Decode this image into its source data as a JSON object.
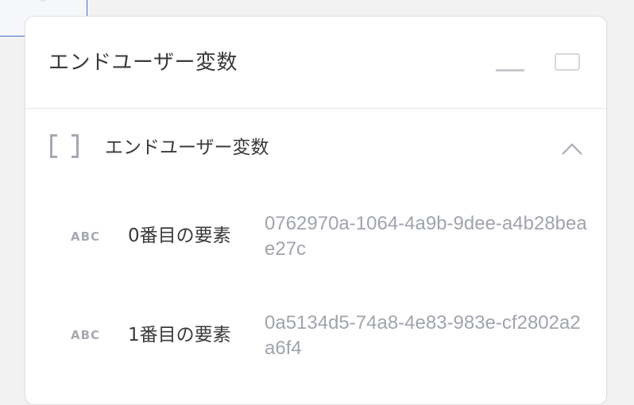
{
  "panel": {
    "title": "エンドユーザー変数",
    "section": {
      "label": "エンドユーザー変数",
      "items": [
        {
          "icon": "ABC",
          "key": "0番目の要素",
          "value": "0762970a-1064-4a9b-9dee-a4b28beae27c"
        },
        {
          "icon": "ABC",
          "key": "1番目の要素",
          "value": "0a5134d5-74a8-4e83-983e-cf2802a2a6f4"
        }
      ]
    }
  }
}
